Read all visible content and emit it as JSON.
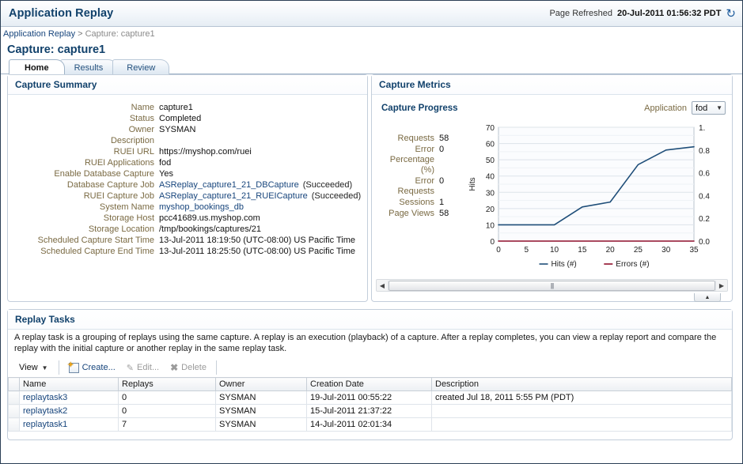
{
  "header": {
    "app_title": "Application Replay",
    "refresh_label": "Page Refreshed",
    "refresh_time": "20-Jul-2011 01:56:32 PDT",
    "refresh_icon": "refresh-icon"
  },
  "breadcrumb": {
    "root": "Application Replay",
    "separator": ">",
    "current": "Capture: capture1"
  },
  "page_title": "Capture: capture1",
  "tabs": [
    {
      "label": "Home",
      "selected": true
    },
    {
      "label": "Results",
      "selected": false
    },
    {
      "label": "Review",
      "selected": false
    }
  ],
  "capture_summary": {
    "title": "Capture Summary",
    "rows": [
      {
        "key": "Name",
        "value": "capture1"
      },
      {
        "key": "Status",
        "value": "Completed"
      },
      {
        "key": "Owner",
        "value": "SYSMAN"
      },
      {
        "key": "Description",
        "value": ""
      },
      {
        "key": "RUEI URL",
        "value": "https://myshop.com/ruei"
      },
      {
        "key": "RUEI Applications",
        "value": "fod"
      },
      {
        "key": "Enable Database Capture",
        "value": "Yes"
      },
      {
        "key": "Database Capture Job",
        "value": "ASReplay_capture1_21_DBCapture",
        "link": true,
        "status": "(Succeeded)"
      },
      {
        "key": "RUEI Capture Job",
        "value": "ASReplay_capture1_21_RUEICapture",
        "link": true,
        "status": "(Succeeded)"
      },
      {
        "key": "System Name",
        "value": "myshop_bookings_db",
        "sysname_link": true
      },
      {
        "key": "Storage Host",
        "value": "pcc41689.us.myshop.com"
      },
      {
        "key": "Storage Location",
        "value": "/tmp/bookings/captures/21"
      },
      {
        "key": "Scheduled Capture Start Time",
        "value": "13-Jul-2011 18:19:50 (UTC-08:00) US Pacific Time"
      },
      {
        "key": "Scheduled Capture End Time",
        "value": "13-Jul-2011 18:25:50 (UTC-08:00) US Pacific Time"
      }
    ]
  },
  "capture_metrics": {
    "title": "Capture Metrics",
    "progress_title": "Capture Progress",
    "application_label": "Application",
    "application_value": "fod",
    "metrics": [
      {
        "key": "Requests",
        "value": "58"
      },
      {
        "key": "Error Percentage (%)",
        "value": "0"
      },
      {
        "key": "Error Requests",
        "value": "0"
      },
      {
        "key": "Sessions",
        "value": "1"
      },
      {
        "key": "Page Views",
        "value": "58"
      }
    ],
    "scroll_left_icon": "arrow-left-icon",
    "scroll_right_icon": "arrow-right-icon",
    "collapse_icon": "collapse-up-icon"
  },
  "chart_data": {
    "type": "line",
    "title": "Capture Progress",
    "xlabel": "",
    "ylabel": "Hits",
    "y2label": "",
    "xlim": [
      0,
      35
    ],
    "ylim": [
      0,
      70
    ],
    "y2lim": [
      0,
      1
    ],
    "xticks": [
      0,
      5,
      10,
      15,
      20,
      25,
      30,
      35
    ],
    "yticks": [
      0,
      10,
      20,
      30,
      40,
      50,
      60,
      70
    ],
    "y2ticks": [
      "0.0",
      "0.2",
      "0.4",
      "0.6",
      "0.8",
      "1."
    ],
    "grid": true,
    "legend_position": "bottom",
    "series": [
      {
        "name": "Hits (#)",
        "color": "#1f4e79",
        "axis": "left",
        "x": [
          0,
          5,
          10,
          15,
          20,
          25,
          30,
          35
        ],
        "values": [
          10,
          10,
          10,
          21,
          24,
          47,
          56,
          58
        ]
      },
      {
        "name": "Errors (#)",
        "color": "#8f0f2b",
        "axis": "right",
        "x": [
          0,
          5,
          10,
          15,
          20,
          25,
          30,
          35
        ],
        "values": [
          0,
          0,
          0,
          0,
          0,
          0,
          0,
          0
        ]
      }
    ]
  },
  "replay_tasks": {
    "title": "Replay Tasks",
    "description": "A replay task is a grouping of replays using the same capture. A replay is an execution (playback) of a capture. After a replay completes, you can view a replay report and compare the replay with the initial capture or another replay in the same replay task.",
    "toolbar": {
      "view_label": "View",
      "create_label": "Create...",
      "edit_label": "Edit...",
      "delete_label": "Delete"
    },
    "columns": [
      "Name",
      "Replays",
      "Owner",
      "Creation Date",
      "Description"
    ],
    "rows": [
      {
        "name": "replaytask3",
        "replays": "0",
        "owner": "SYSMAN",
        "creation_date": "19-Jul-2011 00:55:22",
        "description": "created Jul 18, 2011 5:55 PM (PDT)"
      },
      {
        "name": "replaytask2",
        "replays": "0",
        "owner": "SYSMAN",
        "creation_date": "15-Jul-2011 21:37:22",
        "description": ""
      },
      {
        "name": "replaytask1",
        "replays": "7",
        "owner": "SYSMAN",
        "creation_date": "14-Jul-2011 02:01:34",
        "description": ""
      }
    ]
  }
}
